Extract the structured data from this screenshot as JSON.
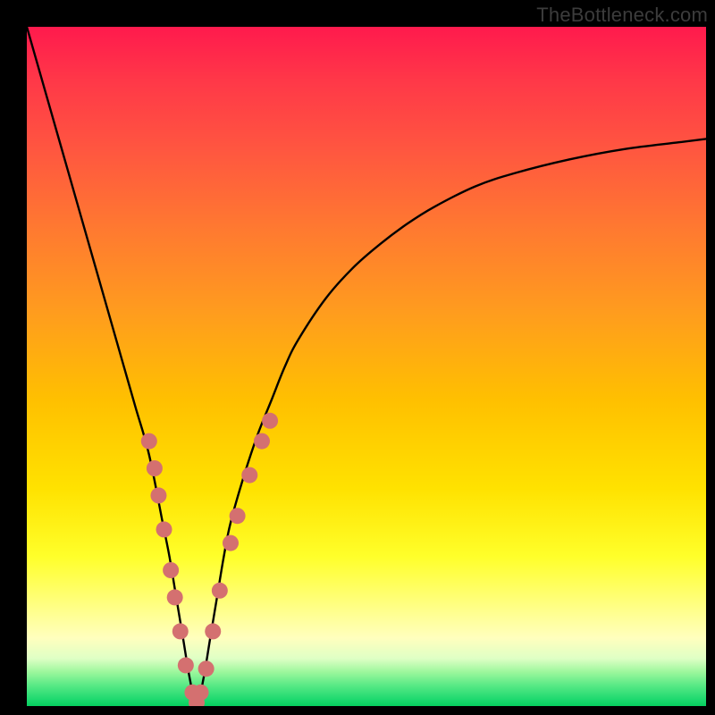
{
  "watermark": "TheBottleneck.com",
  "chart_data": {
    "type": "line",
    "title": "",
    "xlabel": "",
    "ylabel": "",
    "xlim": [
      0,
      100
    ],
    "ylim": [
      0,
      100
    ],
    "grid": false,
    "legend": false,
    "series": [
      {
        "name": "bottleneck-curve",
        "color": "#000000",
        "x": [
          0,
          2,
          4,
          6,
          8,
          10,
          12,
          14,
          16,
          18,
          20,
          21,
          22,
          23,
          24,
          25,
          26,
          27,
          28,
          29,
          30,
          32,
          34,
          36,
          38,
          40,
          44,
          48,
          52,
          56,
          60,
          66,
          72,
          80,
          88,
          96,
          100
        ],
        "y": [
          100,
          93,
          86,
          79,
          72,
          65,
          58,
          51,
          44,
          37,
          27,
          22,
          16,
          10,
          4,
          0,
          4,
          10,
          16,
          22,
          27,
          34,
          40,
          45,
          50,
          54,
          60,
          64.5,
          68,
          71,
          73.5,
          76.5,
          78.5,
          80.5,
          82,
          83,
          83.5
        ]
      }
    ],
    "markers": [
      {
        "name": "data-dots-left",
        "color": "#d47070",
        "radius": 9,
        "points": [
          {
            "x": 18.0,
            "y": 39.0
          },
          {
            "x": 18.8,
            "y": 35.0
          },
          {
            "x": 19.4,
            "y": 31.0
          },
          {
            "x": 20.2,
            "y": 26.0
          },
          {
            "x": 21.2,
            "y": 20.0
          },
          {
            "x": 21.8,
            "y": 16.0
          },
          {
            "x": 22.6,
            "y": 11.0
          },
          {
            "x": 23.4,
            "y": 6.0
          },
          {
            "x": 24.4,
            "y": 2.0
          },
          {
            "x": 25.0,
            "y": 0.5
          },
          {
            "x": 25.6,
            "y": 2.0
          }
        ]
      },
      {
        "name": "data-dots-right",
        "color": "#d47070",
        "radius": 9,
        "points": [
          {
            "x": 26.4,
            "y": 5.5
          },
          {
            "x": 27.4,
            "y": 11.0
          },
          {
            "x": 28.4,
            "y": 17.0
          },
          {
            "x": 30.0,
            "y": 24.0
          },
          {
            "x": 31.0,
            "y": 28.0
          },
          {
            "x": 32.8,
            "y": 34.0
          },
          {
            "x": 34.6,
            "y": 39.0
          },
          {
            "x": 35.8,
            "y": 42.0
          }
        ]
      }
    ],
    "background_gradient": {
      "direction": "vertical",
      "stops": [
        {
          "pos": 0.0,
          "color": "#ff1a4d"
        },
        {
          "pos": 0.3,
          "color": "#ff7a30"
        },
        {
          "pos": 0.55,
          "color": "#ffc000"
        },
        {
          "pos": 0.78,
          "color": "#ffff2a"
        },
        {
          "pos": 0.92,
          "color": "#dfffc5"
        },
        {
          "pos": 1.0,
          "color": "#05cf5f"
        }
      ]
    }
  }
}
